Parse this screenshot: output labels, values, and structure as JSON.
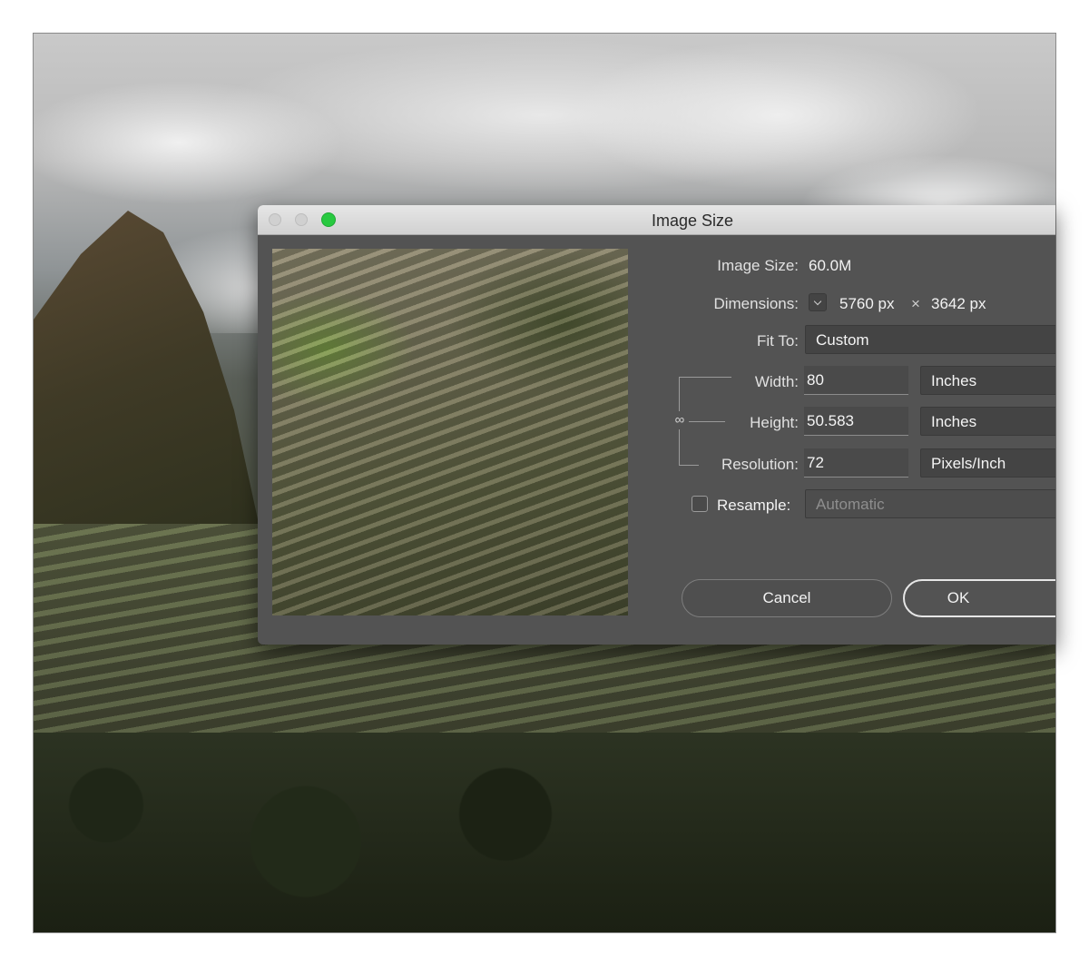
{
  "dialog": {
    "title": "Image Size",
    "image_size": {
      "label": "Image Size:",
      "value": "60.0M"
    },
    "dimensions": {
      "label": "Dimensions:",
      "width": "5760 px",
      "times": "×",
      "height": "3642 px"
    },
    "fit_to": {
      "label": "Fit To:",
      "value": "Custom"
    },
    "width": {
      "label": "Width:",
      "value": "80",
      "unit": "Inches"
    },
    "height": {
      "label": "Height:",
      "value": "50.583",
      "unit": "Inches"
    },
    "resolution": {
      "label": "Resolution:",
      "value": "72",
      "unit": "Pixels/Inch"
    },
    "resample": {
      "label": "Resample:",
      "checked": false,
      "value": "Automatic"
    },
    "buttons": {
      "cancel": "Cancel",
      "ok": "OK"
    },
    "icons": {
      "dimensions_toggle": "chevron-down-icon",
      "constrain": "link-icon"
    }
  },
  "colors": {
    "dialog_bg": "#535353",
    "titlebar_bg": "#d9d9d9",
    "zoom_button": "#28c940",
    "text": "#e2e2e2"
  }
}
